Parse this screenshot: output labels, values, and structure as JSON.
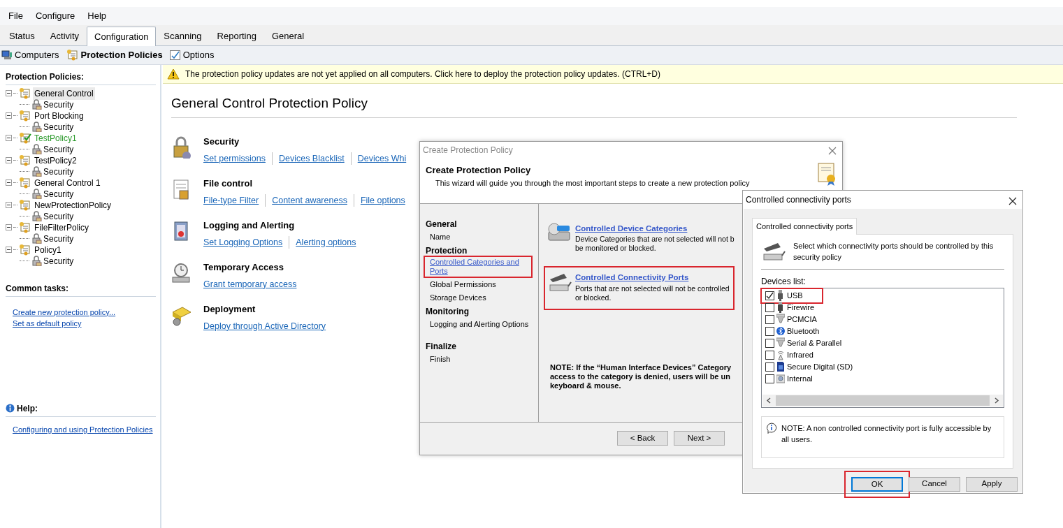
{
  "menu": [
    "File",
    "Configure",
    "Help"
  ],
  "tabs": [
    {
      "label": "Status",
      "selected": false
    },
    {
      "label": "Activity",
      "selected": false
    },
    {
      "label": "Configuration",
      "selected": true
    },
    {
      "label": "Scanning",
      "selected": false
    },
    {
      "label": "Reporting",
      "selected": false
    },
    {
      "label": "General",
      "selected": false
    }
  ],
  "toolbar": [
    {
      "label": "Computers",
      "kind": "computers",
      "selected": false
    },
    {
      "label": "Protection Policies",
      "kind": "policies",
      "selected": true
    },
    {
      "label": "Options",
      "kind": "options",
      "selected": false
    }
  ],
  "sidebar": {
    "title": "Protection Policies:",
    "tree": [
      {
        "label": "General Control",
        "selected": true,
        "default": false,
        "children": [
          {
            "label": "Security"
          }
        ]
      },
      {
        "label": "Port Blocking",
        "selected": false,
        "default": false,
        "children": [
          {
            "label": "Security"
          }
        ]
      },
      {
        "label": "TestPolicy1",
        "selected": false,
        "default": true,
        "children": [
          {
            "label": "Security"
          }
        ]
      },
      {
        "label": "TestPolicy2",
        "selected": false,
        "default": false,
        "children": [
          {
            "label": "Security"
          }
        ]
      },
      {
        "label": "General Control 1",
        "selected": false,
        "default": false,
        "children": [
          {
            "label": "Security"
          }
        ]
      },
      {
        "label": "NewProtectionPolicy",
        "selected": false,
        "default": false,
        "children": [
          {
            "label": "Security"
          }
        ]
      },
      {
        "label": "FileFilterPolicy",
        "selected": false,
        "default": false,
        "children": [
          {
            "label": "Security"
          }
        ]
      },
      {
        "label": "Policy1",
        "selected": false,
        "default": false,
        "children": [
          {
            "label": "Security"
          }
        ]
      }
    ],
    "common_tasks": {
      "title": "Common tasks:",
      "links": [
        "Create new protection policy...",
        "Set as default policy"
      ]
    },
    "help": {
      "title": "Help:",
      "links": [
        "Configuring and using Protection Policies"
      ]
    }
  },
  "banner": {
    "text": "The protection policy updates are not yet applied on all computers. Click here to deploy the protection policy updates. (CTRL+D)"
  },
  "page_title": "General Control Protection Policy",
  "sections": [
    {
      "title": "Security",
      "kind": "security",
      "links": [
        "Set permissions",
        "Devices Blacklist",
        "Devices Whi"
      ]
    },
    {
      "title": "File control",
      "kind": "file",
      "links": [
        "File-type Filter",
        "Content awareness",
        "File options"
      ]
    },
    {
      "title": "Logging and Alerting",
      "kind": "logging",
      "links": [
        "Set Logging Options",
        "Alerting options"
      ]
    },
    {
      "title": "Temporary Access",
      "kind": "temporary",
      "links": [
        "Grant temporary access"
      ]
    },
    {
      "title": "Deployment",
      "kind": "deployment",
      "links": [
        "Deploy through Active Directory"
      ]
    }
  ],
  "wizard": {
    "title": "Create Protection Policy",
    "heading": "Create Protection Policy",
    "subtitle": "This wizard will guide you through the most important steps to create a new protection policy",
    "nav": [
      {
        "text": "General",
        "kind": "group",
        "highlighted": false
      },
      {
        "text": "Name",
        "kind": "step",
        "highlighted": false
      },
      {
        "text": "Protection",
        "kind": "group",
        "highlighted": false
      },
      {
        "text": "Controlled Categories and Ports",
        "kind": "link",
        "highlighted": true
      },
      {
        "text": "Global Permissions",
        "kind": "step",
        "highlighted": false
      },
      {
        "text": "Storage Devices",
        "kind": "step",
        "highlighted": false
      },
      {
        "text": "Monitoring",
        "kind": "group",
        "highlighted": false
      },
      {
        "text": "Logging and Alerting Options",
        "kind": "step",
        "highlighted": false
      },
      {
        "text": "Finalize",
        "kind": "group",
        "highlighted": false
      },
      {
        "text": "Finish",
        "kind": "step",
        "highlighted": false
      }
    ],
    "options": [
      {
        "title": "Controlled Device Categories",
        "kind": "devices",
        "description": [
          "Device Categories that are not selected will not b",
          "be monitored or blocked."
        ],
        "highlighted": false
      },
      {
        "title": "Controlled Connectivity Ports",
        "kind": "ports",
        "description": [
          "Ports that are not selected will not be controlled",
          "or blocked."
        ],
        "highlighted": true
      }
    ],
    "note": [
      "NOTE: If the “Human Interface Devices” Category",
      "access to the category is denied, users will be un",
      "keyboard & mouse."
    ],
    "buttons": [
      "< Back",
      "Next >"
    ]
  },
  "ports_dialog": {
    "title": "Controlled connectivity ports",
    "tab": {
      "label": "Controlled connectivity ports",
      "selected": true
    },
    "intro": "Select which connectivity ports should be controlled by this security policy",
    "list_label": "Devices list:",
    "devices": [
      {
        "label": "USB",
        "kind": "usb",
        "checked": true,
        "highlighted": true
      },
      {
        "label": "Firewire",
        "kind": "firewire",
        "checked": false,
        "highlighted": false
      },
      {
        "label": "PCMCIA",
        "kind": "pcmcia",
        "checked": false,
        "highlighted": false
      },
      {
        "label": "Bluetooth",
        "kind": "bluetooth",
        "checked": false,
        "highlighted": false
      },
      {
        "label": "Serial & Parallel",
        "kind": "serial",
        "checked": false,
        "highlighted": false
      },
      {
        "label": "Infrared",
        "kind": "infrared",
        "checked": false,
        "highlighted": false
      },
      {
        "label": "Secure Digital (SD)",
        "kind": "sd",
        "checked": false,
        "highlighted": false
      },
      {
        "label": "Internal",
        "kind": "internal",
        "checked": false,
        "highlighted": false
      }
    ],
    "note": "NOTE: A non controlled connectivity port is fully accessible by all users.",
    "buttons": [
      {
        "label": "OK",
        "default": true,
        "highlighted": true
      },
      {
        "label": "Cancel",
        "default": false,
        "highlighted": false
      },
      {
        "label": "Apply",
        "default": false,
        "highlighted": false
      }
    ]
  }
}
